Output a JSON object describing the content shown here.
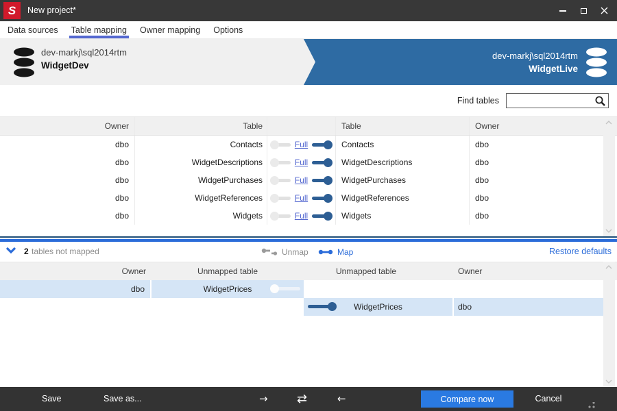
{
  "window": {
    "title": "New project*"
  },
  "icons": {
    "arrow_right": "→",
    "swap": "⇄",
    "arrow_left": "←",
    "logo_letter": "S"
  },
  "tabs": [
    {
      "label": "Data sources",
      "active": false
    },
    {
      "label": "Table mapping",
      "active": true
    },
    {
      "label": "Owner mapping",
      "active": false
    },
    {
      "label": "Options",
      "active": false
    }
  ],
  "source_db": {
    "server": "dev-markj\\sql2014rtm",
    "database": "WidgetDev"
  },
  "target_db": {
    "server": "dev-markj\\sql2014rtm",
    "database": "WidgetLive"
  },
  "search": {
    "label": "Find tables",
    "value": ""
  },
  "mapped_grid": {
    "headers": {
      "left_owner": "Owner",
      "left_table": "Table",
      "right_table": "Table",
      "right_owner": "Owner"
    },
    "rows": [
      {
        "left_owner": "dbo",
        "left_table": "Contacts",
        "mapping": "Full",
        "right_table": "Contacts",
        "right_owner": "dbo"
      },
      {
        "left_owner": "dbo",
        "left_table": "WidgetDescriptions",
        "mapping": "Full",
        "right_table": "WidgetDescriptions",
        "right_owner": "dbo"
      },
      {
        "left_owner": "dbo",
        "left_table": "WidgetPurchases",
        "mapping": "Full",
        "right_table": "WidgetPurchases",
        "right_owner": "dbo"
      },
      {
        "left_owner": "dbo",
        "left_table": "WidgetReferences",
        "mapping": "Full",
        "right_table": "WidgetReferences",
        "right_owner": "dbo"
      },
      {
        "left_owner": "dbo",
        "left_table": "Widgets",
        "mapping": "Full",
        "right_table": "Widgets",
        "right_owner": "dbo"
      }
    ]
  },
  "unmapped_bar": {
    "count": "2",
    "label": "tables not mapped",
    "unmap": "Unmap",
    "map": "Map",
    "restore": "Restore defaults"
  },
  "unmapped_grid": {
    "headers": {
      "left_owner": "Owner",
      "left_table": "Unmapped table",
      "right_table": "Unmapped table",
      "right_owner": "Owner"
    },
    "left_rows": [
      {
        "owner": "dbo",
        "table": "WidgetPrices"
      }
    ],
    "right_rows": [
      {
        "table": "WidgetPrices",
        "owner": "dbo"
      }
    ]
  },
  "toolbar": {
    "save": "Save",
    "save_as": "Save as...",
    "compare": "Compare now",
    "cancel": "Cancel"
  },
  "colors": {
    "titlebar": "#383838",
    "logo_red": "#d11a2b",
    "tab_underline": "#5468d0",
    "header_blue": "#2e6ba3",
    "splitter_blue": "#2b6cd9",
    "toggle_blue": "#2d5e94",
    "link_blue": "#5468d0",
    "row_highlight": "#d5e5f6",
    "compare_button": "#2a7ae2"
  }
}
